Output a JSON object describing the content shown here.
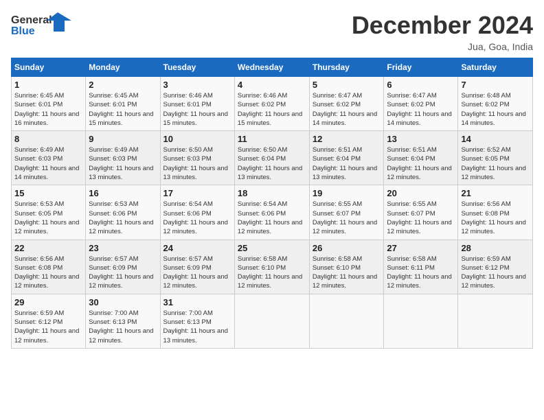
{
  "header": {
    "logo_line1": "General",
    "logo_line2": "Blue",
    "month_title": "December 2024",
    "location": "Jua, Goa, India"
  },
  "days_of_week": [
    "Sunday",
    "Monday",
    "Tuesday",
    "Wednesday",
    "Thursday",
    "Friday",
    "Saturday"
  ],
  "weeks": [
    [
      {
        "day": "1",
        "info": "Sunrise: 6:45 AM\nSunset: 6:01 PM\nDaylight: 11 hours and 16 minutes."
      },
      {
        "day": "2",
        "info": "Sunrise: 6:45 AM\nSunset: 6:01 PM\nDaylight: 11 hours and 15 minutes."
      },
      {
        "day": "3",
        "info": "Sunrise: 6:46 AM\nSunset: 6:01 PM\nDaylight: 11 hours and 15 minutes."
      },
      {
        "day": "4",
        "info": "Sunrise: 6:46 AM\nSunset: 6:02 PM\nDaylight: 11 hours and 15 minutes."
      },
      {
        "day": "5",
        "info": "Sunrise: 6:47 AM\nSunset: 6:02 PM\nDaylight: 11 hours and 14 minutes."
      },
      {
        "day": "6",
        "info": "Sunrise: 6:47 AM\nSunset: 6:02 PM\nDaylight: 11 hours and 14 minutes."
      },
      {
        "day": "7",
        "info": "Sunrise: 6:48 AM\nSunset: 6:02 PM\nDaylight: 11 hours and 14 minutes."
      }
    ],
    [
      {
        "day": "8",
        "info": "Sunrise: 6:49 AM\nSunset: 6:03 PM\nDaylight: 11 hours and 14 minutes."
      },
      {
        "day": "9",
        "info": "Sunrise: 6:49 AM\nSunset: 6:03 PM\nDaylight: 11 hours and 13 minutes."
      },
      {
        "day": "10",
        "info": "Sunrise: 6:50 AM\nSunset: 6:03 PM\nDaylight: 11 hours and 13 minutes."
      },
      {
        "day": "11",
        "info": "Sunrise: 6:50 AM\nSunset: 6:04 PM\nDaylight: 11 hours and 13 minutes."
      },
      {
        "day": "12",
        "info": "Sunrise: 6:51 AM\nSunset: 6:04 PM\nDaylight: 11 hours and 13 minutes."
      },
      {
        "day": "13",
        "info": "Sunrise: 6:51 AM\nSunset: 6:04 PM\nDaylight: 11 hours and 12 minutes."
      },
      {
        "day": "14",
        "info": "Sunrise: 6:52 AM\nSunset: 6:05 PM\nDaylight: 11 hours and 12 minutes."
      }
    ],
    [
      {
        "day": "15",
        "info": "Sunrise: 6:53 AM\nSunset: 6:05 PM\nDaylight: 11 hours and 12 minutes."
      },
      {
        "day": "16",
        "info": "Sunrise: 6:53 AM\nSunset: 6:06 PM\nDaylight: 11 hours and 12 minutes."
      },
      {
        "day": "17",
        "info": "Sunrise: 6:54 AM\nSunset: 6:06 PM\nDaylight: 11 hours and 12 minutes."
      },
      {
        "day": "18",
        "info": "Sunrise: 6:54 AM\nSunset: 6:06 PM\nDaylight: 11 hours and 12 minutes."
      },
      {
        "day": "19",
        "info": "Sunrise: 6:55 AM\nSunset: 6:07 PM\nDaylight: 11 hours and 12 minutes."
      },
      {
        "day": "20",
        "info": "Sunrise: 6:55 AM\nSunset: 6:07 PM\nDaylight: 11 hours and 12 minutes."
      },
      {
        "day": "21",
        "info": "Sunrise: 6:56 AM\nSunset: 6:08 PM\nDaylight: 11 hours and 12 minutes."
      }
    ],
    [
      {
        "day": "22",
        "info": "Sunrise: 6:56 AM\nSunset: 6:08 PM\nDaylight: 11 hours and 12 minutes."
      },
      {
        "day": "23",
        "info": "Sunrise: 6:57 AM\nSunset: 6:09 PM\nDaylight: 11 hours and 12 minutes."
      },
      {
        "day": "24",
        "info": "Sunrise: 6:57 AM\nSunset: 6:09 PM\nDaylight: 11 hours and 12 minutes."
      },
      {
        "day": "25",
        "info": "Sunrise: 6:58 AM\nSunset: 6:10 PM\nDaylight: 11 hours and 12 minutes."
      },
      {
        "day": "26",
        "info": "Sunrise: 6:58 AM\nSunset: 6:10 PM\nDaylight: 11 hours and 12 minutes."
      },
      {
        "day": "27",
        "info": "Sunrise: 6:58 AM\nSunset: 6:11 PM\nDaylight: 11 hours and 12 minutes."
      },
      {
        "day": "28",
        "info": "Sunrise: 6:59 AM\nSunset: 6:12 PM\nDaylight: 11 hours and 12 minutes."
      }
    ],
    [
      {
        "day": "29",
        "info": "Sunrise: 6:59 AM\nSunset: 6:12 PM\nDaylight: 11 hours and 12 minutes."
      },
      {
        "day": "30",
        "info": "Sunrise: 7:00 AM\nSunset: 6:13 PM\nDaylight: 11 hours and 12 minutes."
      },
      {
        "day": "31",
        "info": "Sunrise: 7:00 AM\nSunset: 6:13 PM\nDaylight: 11 hours and 13 minutes."
      },
      {
        "day": "",
        "info": ""
      },
      {
        "day": "",
        "info": ""
      },
      {
        "day": "",
        "info": ""
      },
      {
        "day": "",
        "info": ""
      }
    ]
  ]
}
